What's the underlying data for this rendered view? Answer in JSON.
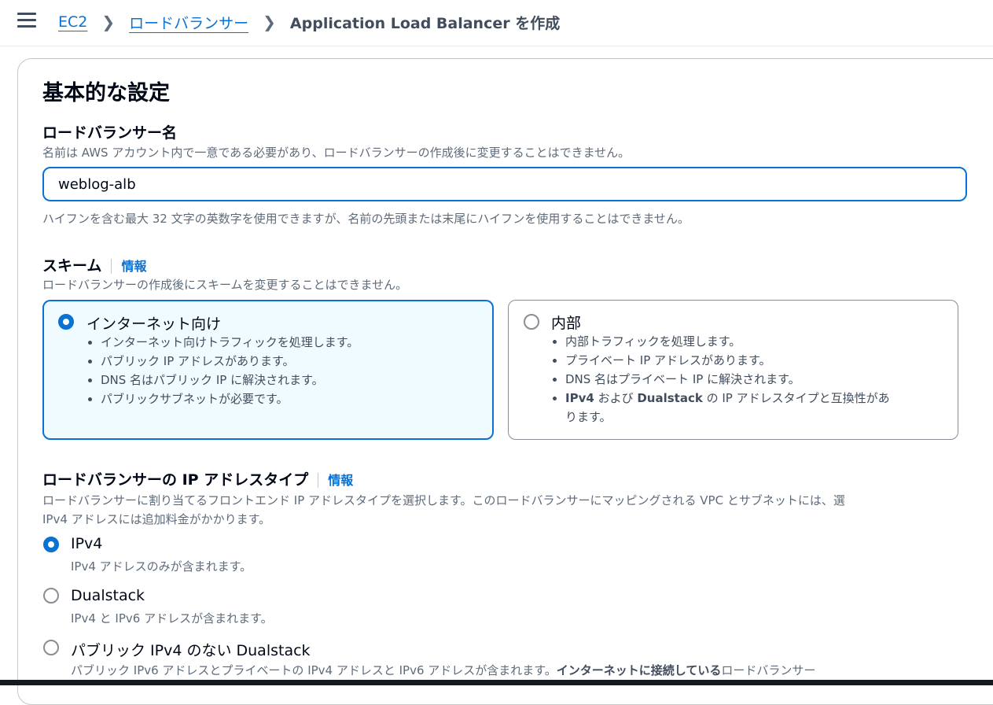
{
  "breadcrumb": {
    "items": [
      "EC2",
      "ロードバランサー"
    ],
    "current": "Application Load Balancer を作成"
  },
  "section": {
    "title": "基本的な設定"
  },
  "lb_name": {
    "label": "ロードバランサー名",
    "description": "名前は AWS アカウント内で一意である必要があり、ロードバランサーの作成後に変更することはできません。",
    "value": "weblog-alb",
    "constraint": "ハイフンを含む最大 32 文字の英数字を使用できますが、名前の先頭または末尾にハイフンを使用することはできません。"
  },
  "scheme": {
    "label": "スキーム",
    "info": "情報",
    "description": "ロードバランサーの作成後にスキームを変更することはできません。",
    "options": [
      {
        "label": "インターネット向け",
        "selected": true,
        "bullets": [
          "インターネット向けトラフィックを処理します。",
          "パブリック IP アドレスがあります。",
          "DNS 名はパブリック IP に解決されます。",
          "パブリックサブネットが必要です。"
        ]
      },
      {
        "label": "内部",
        "selected": false,
        "bullets": [
          "内部トラフィックを処理します。",
          "プライベート IP アドレスがあります。",
          "DNS 名はプライベート IP に解決されます。"
        ],
        "last_bullet": {
          "part1": "IPv4",
          "part2": " および ",
          "part3": "Dualstack",
          "part4": " の IP アドレスタイプと互換性があ",
          "part5": "ります。"
        }
      }
    ]
  },
  "ip_type": {
    "label": "ロードバランサーの IP アドレスタイプ",
    "info": "情報",
    "description_line1": "ロードバランサーに割り当てるフロントエンド IP アドレスタイプを選択します。このロードバランサーにマッピングされる VPC とサブネットには、選",
    "description_line2": "IPv4 アドレスには追加料金がかかります。",
    "options": [
      {
        "label": "IPv4",
        "description": "IPv4 アドレスのみが含まれます。",
        "selected": true
      },
      {
        "label": "Dualstack",
        "description": "IPv4 と IPv6 アドレスが含まれます。",
        "selected": false
      },
      {
        "label": "パブリック IPv4 のない Dualstack",
        "selected": false,
        "description_part1": "パブリック IPv6 アドレスとプライベートの IPv4 アドレスと IPv6 アドレスが含まれます。",
        "description_bold": "インターネットに接続している",
        "description_part2": "ロードバランサー"
      }
    ]
  },
  "colors": {
    "accent": "#0972d3",
    "selected_tile_bg": "#f0fbff",
    "text": "#000716",
    "muted": "#5f6b7a"
  }
}
